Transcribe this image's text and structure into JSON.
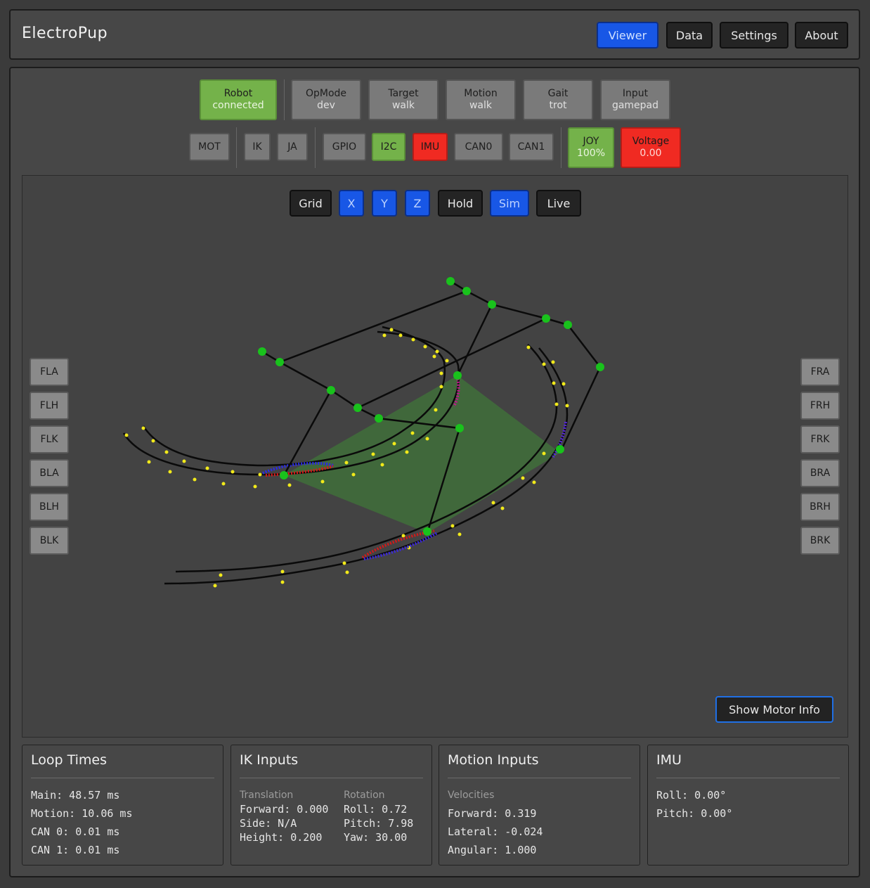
{
  "header": {
    "title": "ElectroPup",
    "nav": [
      {
        "label": "Viewer",
        "active": true
      },
      {
        "label": "Data",
        "active": false
      },
      {
        "label": "Settings",
        "active": false
      },
      {
        "label": "About",
        "active": false
      }
    ]
  },
  "status_top": [
    {
      "label": "Robot",
      "value": "connected",
      "state": "green"
    },
    {
      "label": "OpMode",
      "value": "dev",
      "state": "gray"
    },
    {
      "label": "Target",
      "value": "walk",
      "state": "gray"
    },
    {
      "label": "Motion",
      "value": "walk",
      "state": "gray"
    },
    {
      "label": "Gait",
      "value": "trot",
      "state": "gray"
    },
    {
      "label": "Input",
      "value": "gamepad",
      "state": "gray"
    }
  ],
  "status_bottom": {
    "mot": "MOT",
    "ik": "IK",
    "ja": "JA",
    "gpio": "GPIO",
    "i2c": "I2C",
    "imu": "IMU",
    "can0": "CAN0",
    "can1": "CAN1",
    "joy": {
      "label": "JOY",
      "value": "100%"
    },
    "voltage": {
      "label": "Voltage",
      "value": "0.00"
    }
  },
  "viewer_toolbar": {
    "grid": "Grid",
    "x": "X",
    "y": "Y",
    "z": "Z",
    "hold": "Hold",
    "sim": "Sim",
    "live": "Live"
  },
  "motors_left": [
    "FLA",
    "FLH",
    "FLK",
    "BLA",
    "BLH",
    "BLK"
  ],
  "motors_right": [
    "FRA",
    "FRH",
    "FRK",
    "BRA",
    "BRH",
    "BRK"
  ],
  "show_motor_info": "Show Motor Info",
  "colors": {
    "accent_blue": "#1857e6",
    "status_green": "#74b24a",
    "status_red": "#f02a22",
    "joint_green": "#19c21c",
    "trajectory_yellow": "#f2ea1a",
    "support_polygon": "#3f6e3a"
  },
  "loop_times": {
    "title": "Loop Times",
    "main": "Main: 48.57 ms",
    "motion": "Motion: 10.06 ms",
    "can0": "CAN 0: 0.01 ms",
    "can1": "CAN 1: 0.01 ms"
  },
  "ik_inputs": {
    "title": "IK Inputs",
    "translation_label": "Translation",
    "rotation_label": "Rotation",
    "forward": "Forward: 0.000",
    "side": "Side: N/A",
    "height": "Height: 0.200",
    "roll": "Roll: 0.72",
    "pitch": "Pitch: 7.98",
    "yaw": "Yaw: 30.00"
  },
  "motion_inputs": {
    "title": "Motion Inputs",
    "velocities_label": "Velocities",
    "forward": "Forward: 0.319",
    "lateral": "Lateral: -0.024",
    "angular": "Angular: 1.000"
  },
  "imu": {
    "title": "IMU",
    "roll": "Roll: 0.00°",
    "pitch": "Pitch: 0.00°"
  }
}
